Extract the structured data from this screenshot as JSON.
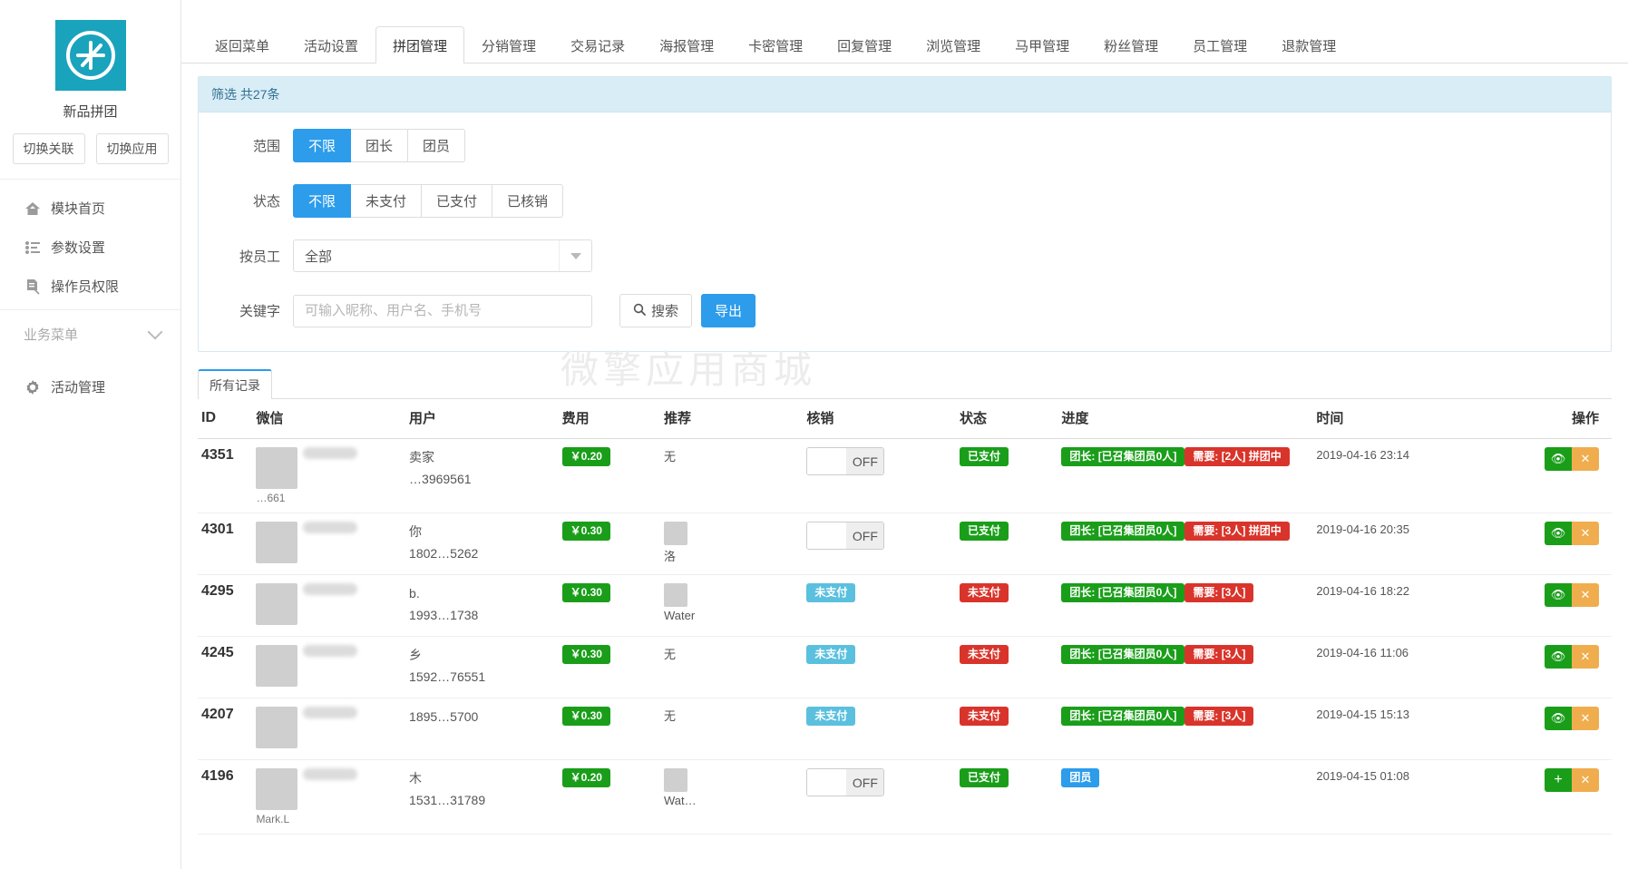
{
  "sidebar": {
    "app_name": "新品拼团",
    "logo_icon": "compass-arrow-logo",
    "buttons": [
      {
        "label": "切换关联",
        "name": "switch-relation-button"
      },
      {
        "label": "切换应用",
        "name": "switch-app-button"
      }
    ],
    "menu": [
      {
        "label": "模块首页",
        "icon": "home-icon"
      },
      {
        "label": "参数设置",
        "icon": "list-settings-icon"
      },
      {
        "label": "操作员权限",
        "icon": "document-edit-icon"
      }
    ],
    "group_title": "业务菜单",
    "group_items": [
      {
        "label": "活动管理",
        "icon": "gear-icon"
      }
    ]
  },
  "tabs": [
    {
      "label": "返回菜单",
      "active": false
    },
    {
      "label": "活动设置",
      "active": false
    },
    {
      "label": "拼团管理",
      "active": true
    },
    {
      "label": "分销管理",
      "active": false
    },
    {
      "label": "交易记录",
      "active": false
    },
    {
      "label": "海报管理",
      "active": false
    },
    {
      "label": "卡密管理",
      "active": false
    },
    {
      "label": "回复管理",
      "active": false
    },
    {
      "label": "浏览管理",
      "active": false
    },
    {
      "label": "马甲管理",
      "active": false
    },
    {
      "label": "粉丝管理",
      "active": false
    },
    {
      "label": "员工管理",
      "active": false
    },
    {
      "label": "退款管理",
      "active": false
    }
  ],
  "filter": {
    "header": "筛选 共27条",
    "scope": {
      "label": "范围",
      "options": [
        "不限",
        "团长",
        "团员"
      ],
      "selected": "不限"
    },
    "status": {
      "label": "状态",
      "options": [
        "不限",
        "未支付",
        "已支付",
        "已核销"
      ],
      "selected": "不限"
    },
    "staff": {
      "label": "按员工",
      "value": "全部"
    },
    "keyword": {
      "label": "关键字",
      "value": "",
      "placeholder": "可输入昵称、用户名、手机号"
    },
    "search_label": "搜索",
    "search_icon": "search-icon",
    "export_label": "导出"
  },
  "table": {
    "tab_label": "所有记录",
    "watermark": "微擎应用商城",
    "columns": [
      "ID",
      "微信",
      "用户",
      "费用",
      "推荐",
      "核销",
      "状态",
      "进度",
      "时间",
      "操作"
    ],
    "rows": [
      {
        "id": "4351",
        "wx_name": "…661",
        "user_name": "卖家",
        "user_phone": "…3969561",
        "fee": "￥0.20",
        "referrer": "无",
        "referrer_avatar": false,
        "hx_type": "toggle",
        "hx_label": "OFF",
        "status": "已支付",
        "status_color": "green",
        "progress": [
          {
            "text": "团长: [已召集团员0人]",
            "color": "green"
          },
          {
            "text": "需要: [2人] 拼团中",
            "color": "red"
          }
        ],
        "time": "2019-04-16 23:14",
        "ops": [
          "view",
          "delete"
        ]
      },
      {
        "id": "4301",
        "wx_name": "",
        "user_name": "你",
        "user_phone": "1802…5262",
        "fee": "￥0.30",
        "referrer": "洛",
        "referrer_avatar": true,
        "hx_type": "toggle",
        "hx_label": "OFF",
        "status": "已支付",
        "status_color": "green",
        "progress": [
          {
            "text": "团长: [已召集团员0人]",
            "color": "green"
          },
          {
            "text": "需要: [3人] 拼团中",
            "color": "red"
          }
        ],
        "time": "2019-04-16 20:35",
        "ops": [
          "view",
          "delete"
        ]
      },
      {
        "id": "4295",
        "wx_name": "",
        "user_name": "b.",
        "user_phone": "1993…1738",
        "fee": "￥0.30",
        "referrer": "Water",
        "referrer_avatar": true,
        "hx_type": "tag",
        "hx_label": "未支付",
        "status": "未支付",
        "status_color": "red",
        "progress": [
          {
            "text": "团长: [已召集团员0人]",
            "color": "green"
          },
          {
            "text": "需要: [3人]",
            "color": "red"
          }
        ],
        "time": "2019-04-16 18:22",
        "ops": [
          "view",
          "delete"
        ]
      },
      {
        "id": "4245",
        "wx_name": "",
        "user_name": "乡",
        "user_phone": "1592…76551",
        "fee": "￥0.30",
        "referrer": "无",
        "referrer_avatar": false,
        "hx_type": "tag",
        "hx_label": "未支付",
        "status": "未支付",
        "status_color": "red",
        "progress": [
          {
            "text": "团长: [已召集团员0人]",
            "color": "green"
          },
          {
            "text": "需要: [3人]",
            "color": "red"
          }
        ],
        "time": "2019-04-16 11:06",
        "ops": [
          "view",
          "delete"
        ]
      },
      {
        "id": "4207",
        "wx_name": "",
        "user_name": "",
        "user_phone": "1895…5700",
        "fee": "￥0.30",
        "referrer": "无",
        "referrer_avatar": false,
        "hx_type": "tag",
        "hx_label": "未支付",
        "status": "未支付",
        "status_color": "red",
        "progress": [
          {
            "text": "团长: [已召集团员0人]",
            "color": "green"
          },
          {
            "text": "需要: [3人]",
            "color": "red"
          }
        ],
        "time": "2019-04-15 15:13",
        "ops": [
          "view",
          "delete"
        ]
      },
      {
        "id": "4196",
        "wx_name": "Mark.L",
        "user_name": "木",
        "user_phone": "1531…31789",
        "fee": "￥0.20",
        "referrer": "Wat…",
        "referrer_avatar": true,
        "hx_type": "toggle",
        "hx_label": "OFF",
        "status": "已支付",
        "status_color": "green",
        "progress": [
          {
            "text": "团员",
            "color": "blue"
          }
        ],
        "time": "2019-04-15 01:08",
        "ops": [
          "add",
          "delete"
        ]
      }
    ]
  },
  "colors": {
    "accent": "#2c9ceb",
    "green": "#1a9e1a",
    "red": "#d9342b",
    "light_blue": "#5bc0de",
    "orange": "#f0ad4e",
    "logo": "#1aa3bd",
    "panel_head": "#d9edf7"
  }
}
